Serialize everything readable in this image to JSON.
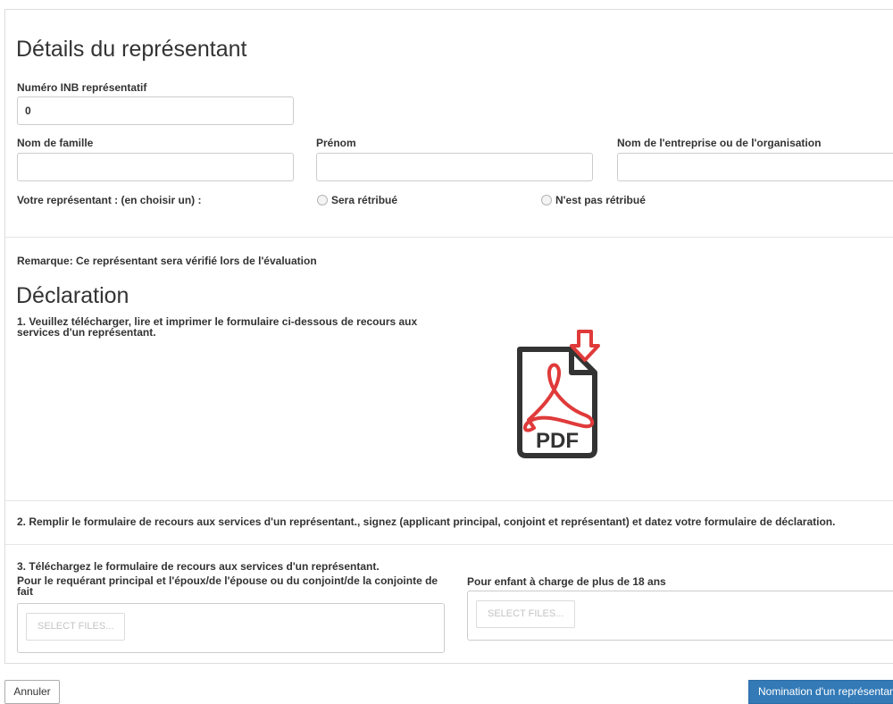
{
  "representative": {
    "title": "Détails du représentant",
    "inb_label": "Numéro INB représentatif",
    "inb_value": "0",
    "last_name_label": "Nom de famille",
    "last_name_value": "",
    "first_name_label": "Prénom",
    "first_name_value": "",
    "company_label": "Nom de l'entreprise ou de l'organisation",
    "company_value": "",
    "choice_label": "Votre représentant : (en choisir un) :",
    "option_paid": "Sera rétribué",
    "option_unpaid": "N'est pas rétribué",
    "note": "Remarque: Ce représentant sera vérifié lors de l'évaluation"
  },
  "declaration": {
    "title": "Déclaration",
    "step1": "1. Veuillez télécharger, lire et imprimer le formulaire ci-dessous de recours aux services d'un représentant.",
    "pdf_text": "PDF",
    "pdf_icon": "pdf-download-icon",
    "step2": "2. Remplir le formulaire de recours aux services d'un représentant., signez (applicant principal, conjoint et représentant) et datez votre formulaire de déclaration.",
    "step3": "3. Téléchargez le formulaire de recours aux services d'un représentant.",
    "upload_principal_label": "Pour le requérant principal et l'époux/de l'épouse ou du conjoint/de la conjointe de fait",
    "upload_child_label": "Pour enfant à charge de plus de 18 ans",
    "select_files": "SELECT FILES..."
  },
  "footer": {
    "cancel": "Annuler",
    "submit": "Nomination d'un représentant"
  },
  "colors": {
    "primary": "#337ab7",
    "pdf_red": "#e03a3a",
    "pdf_dark": "#333333"
  }
}
